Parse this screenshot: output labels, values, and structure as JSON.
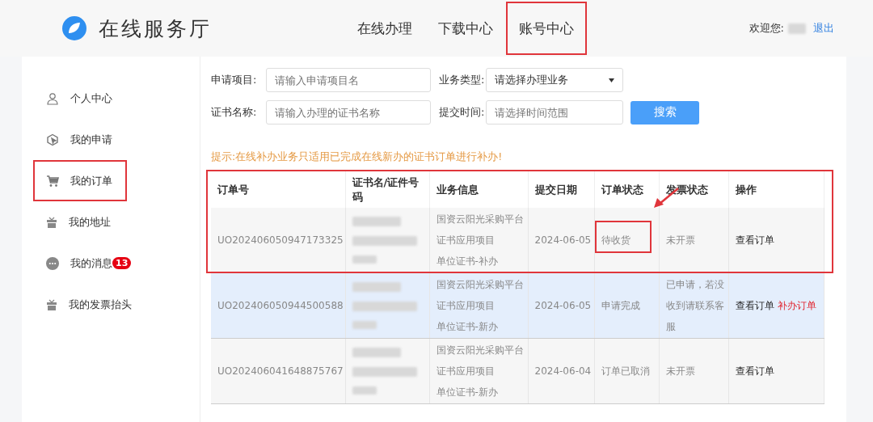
{
  "header": {
    "title": "在线服务厅",
    "nav": [
      {
        "label": "在线办理",
        "annotated": false
      },
      {
        "label": "下载中心",
        "annotated": false
      },
      {
        "label": "账号中心",
        "annotated": true
      }
    ],
    "welcome": "欢迎您:",
    "logout": "退出"
  },
  "sidebar": {
    "items": [
      {
        "label": "个人中心",
        "annotated": false
      },
      {
        "label": "我的申请",
        "annotated": false
      },
      {
        "label": "我的订单",
        "annotated": true
      },
      {
        "label": "我的地址",
        "annotated": false
      },
      {
        "label": "我的消息",
        "badge": "13",
        "annotated": false
      },
      {
        "label": "我的发票抬头",
        "annotated": false
      }
    ]
  },
  "filters": {
    "project": {
      "label": "申请项目:",
      "placeholder": "请输入申请项目名"
    },
    "type": {
      "label": "业务类型:",
      "value": "请选择办理业务"
    },
    "cert": {
      "label": "证书名称:",
      "placeholder": "请输入办理的证书名称"
    },
    "time": {
      "label": "提交时间:",
      "placeholder": "请选择时间范围"
    },
    "search": "搜索"
  },
  "tip": "提示:在线补办业务只适用已完成在线新办的证书订单进行补办!",
  "table": {
    "columns": [
      "订单号",
      "证书名/证件号码",
      "业务信息",
      "提交日期",
      "订单状态",
      "发票状态",
      "操作"
    ],
    "rows": [
      {
        "order": "UO202406050947173325",
        "business": [
          "国资云阳光采购平台",
          "证书应用项目",
          "单位证书-补办"
        ],
        "date": "2024-06-05",
        "status": "待收货",
        "status_annotated": true,
        "invoice": "未开票",
        "actions": [
          {
            "label": "查看订单",
            "kind": "view"
          }
        ],
        "selected": false,
        "annotated": true
      },
      {
        "order": "UO202406050944500588",
        "business": [
          "国资云阳光采购平台",
          "证书应用项目",
          "单位证书-新办"
        ],
        "date": "2024-06-05",
        "status": "申请完成",
        "status_annotated": false,
        "invoice": "已申请，若没收到请联系客服",
        "actions": [
          {
            "label": "查看订单",
            "kind": "view"
          },
          {
            "label": "补办订单",
            "kind": "reissue"
          }
        ],
        "selected": true,
        "annotated": false
      },
      {
        "order": "UO202406041648875767",
        "business": [
          "国资云阳光采购平台",
          "证书应用项目",
          "单位证书-新办"
        ],
        "date": "2024-06-04",
        "status": "订单已取消",
        "status_annotated": false,
        "invoice": "未开票",
        "actions": [
          {
            "label": "查看订单",
            "kind": "view"
          }
        ],
        "selected": false,
        "annotated": false
      }
    ]
  }
}
